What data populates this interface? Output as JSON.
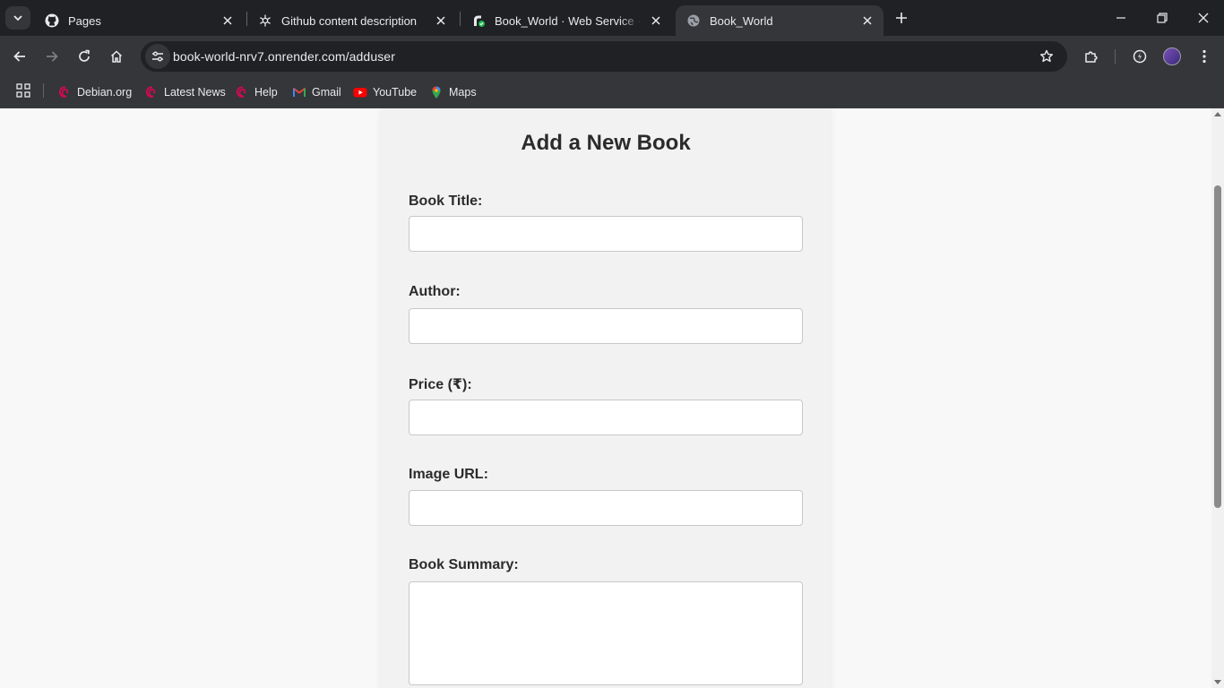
{
  "browser": {
    "tabs": [
      {
        "title": "Pages",
        "icon": "github-icon"
      },
      {
        "title": "Github content description",
        "icon": "openai-icon"
      },
      {
        "title": "Book_World · Web Service · Re",
        "icon": "render-icon"
      },
      {
        "title": "Book_World",
        "icon": "globe-icon",
        "active": true
      }
    ],
    "address": "book-world-nrv7.onrender.com/adduser",
    "bookmarks": [
      {
        "label": "Debian.org",
        "icon": "debian-icon"
      },
      {
        "label": "Latest News",
        "icon": "debian-icon"
      },
      {
        "label": "Help",
        "icon": "debian-icon"
      },
      {
        "label": "Gmail",
        "icon": "gmail-icon"
      },
      {
        "label": "YouTube",
        "icon": "youtube-icon"
      },
      {
        "label": "Maps",
        "icon": "maps-icon"
      }
    ]
  },
  "form": {
    "heading": "Add a New Book",
    "fields": {
      "title": {
        "label": "Book Title:",
        "value": ""
      },
      "author": {
        "label": "Author:",
        "value": ""
      },
      "price": {
        "label": "Price (₹):",
        "value": ""
      },
      "image": {
        "label": "Image URL:",
        "value": ""
      },
      "summary": {
        "label": "Book Summary:",
        "value": ""
      }
    }
  },
  "colors": {
    "chrome_dark": "#202124",
    "chrome_toolbar": "#35363a",
    "page_bg": "#f8f8f8",
    "card_bg": "#f2f2f2",
    "text": "#2b2b2b"
  }
}
